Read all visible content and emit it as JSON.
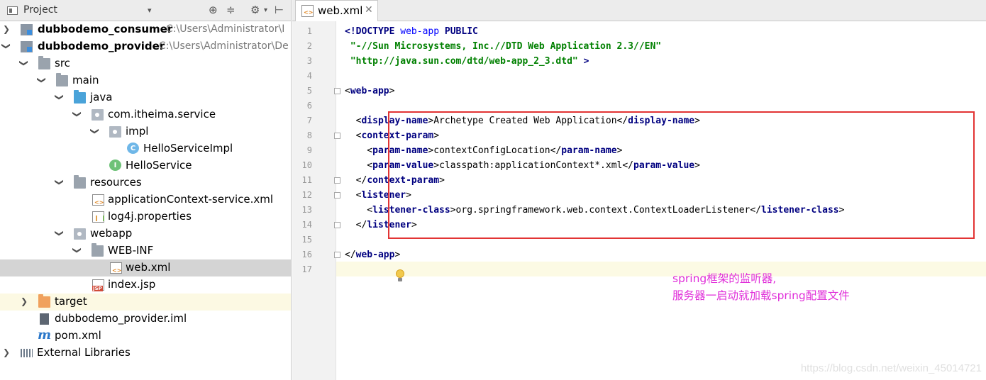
{
  "project_panel": {
    "title": "Project",
    "dropdown_glyph": "▾",
    "toolbar_icons": [
      "target-icon",
      "collapse-icon",
      "gear-icon",
      "hide-icon"
    ]
  },
  "tree": {
    "consumer": {
      "name": "dubbodemo_consumer",
      "path": "C:\\Users\\Administrator\\I"
    },
    "provider": {
      "name": "dubbodemo_provider",
      "path": "C:\\Users\\Administrator\\De"
    },
    "src": "src",
    "main": "main",
    "java": "java",
    "service_pkg": "com.itheima.service",
    "impl_pkg": "impl",
    "impl_class": "HelloServiceImpl",
    "interface": "HelloService",
    "resources": "resources",
    "app_context": "applicationContext-service.xml",
    "log4j": "log4j.properties",
    "webapp": "webapp",
    "webinf": "WEB-INF",
    "webxml": "web.xml",
    "indexjsp": "index.jsp",
    "target": "target",
    "iml": "dubbodemo_provider.iml",
    "pom": "pom.xml",
    "ext_libs": "External Libraries",
    "class_badge": "C",
    "interface_badge": "I",
    "maven_badge": "m"
  },
  "editor": {
    "tab_label": "web.xml",
    "tab_close": "✕",
    "line_numbers": [
      "1",
      "2",
      "3",
      "4",
      "5",
      "6",
      "7",
      "8",
      "9",
      "10",
      "11",
      "12",
      "13",
      "14",
      "15",
      "16",
      "17"
    ],
    "code": {
      "l1_doctype": "<!DOCTYPE",
      "l1_root": "web-app",
      "l1_public": "PUBLIC",
      "l2_string": "\"-//Sun Microsystems, Inc.//DTD Web Application 2.3//EN\"",
      "l3_string": "\"http://java.sun.com/dtd/web-app_2_3.dtd\"",
      "l3_close": ">",
      "tag_web_app": "web-app",
      "tag_display_name": "display-name",
      "display_name_value": "Archetype Created Web Application",
      "tag_context_param": "context-param",
      "tag_param_name": "param-name",
      "param_name_value": "contextConfigLocation",
      "tag_param_value": "param-value",
      "param_value_value": "classpath:applicationContext*.xml",
      "tag_listener": "listener",
      "tag_listener_class": "listener-class",
      "listener_class_value": "org.springframework.web.context.ContextLoaderListener"
    },
    "annotation_line1": "spring框架的监听器,",
    "annotation_line2": "服务器一启动就加载spring配置文件",
    "highlight_color": "#e23434",
    "annotation_color": "#e02fd9"
  },
  "watermark": "https://blog.csdn.net/weixin_45014721"
}
